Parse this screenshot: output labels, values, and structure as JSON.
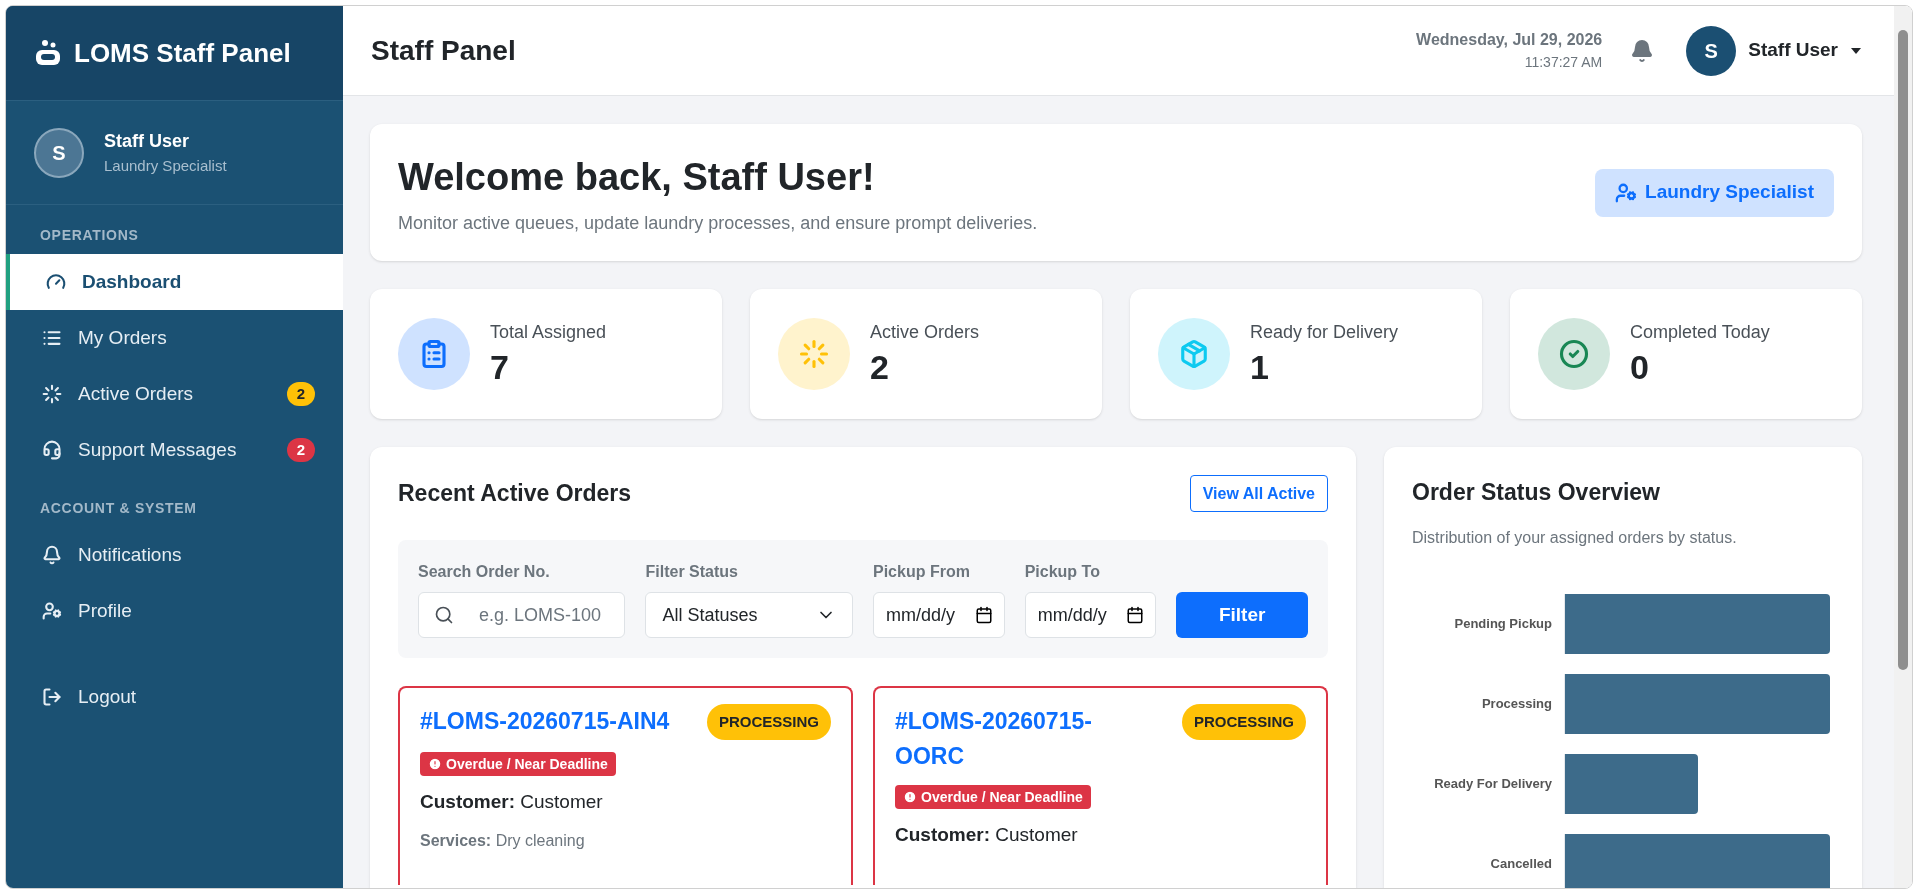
{
  "sidebar": {
    "brand": "LOMS Staff Panel",
    "user": {
      "initial": "S",
      "name": "Staff User",
      "role": "Laundry Specialist"
    },
    "sections": [
      {
        "title": "OPERATIONS",
        "items": [
          {
            "label": "Dashboard",
            "selected": true
          },
          {
            "label": "My Orders",
            "selected": false
          },
          {
            "label": "Active Orders",
            "selected": false,
            "badge": "2",
            "color": "#ffc107"
          },
          {
            "label": "Support Messages",
            "selected": false,
            "badge": "2",
            "color": "#dc3545"
          }
        ]
      },
      {
        "title": "ACCOUNT & SYSTEM",
        "items": [
          {
            "label": "Notifications",
            "selected": false
          },
          {
            "label": "Profile",
            "selected": false
          }
        ]
      }
    ],
    "logout": "Logout"
  },
  "header": {
    "title": "Staff Panel",
    "date": "Wednesday, Jul 29, 2026",
    "time": "11:37:27 AM",
    "user": {
      "initial": "S",
      "name": "Staff User"
    }
  },
  "welcome": {
    "title": "Welcome back, Staff User!",
    "subtitle": "Monitor active queues, update laundry processes, and ensure prompt deliveries.",
    "role_badge": "Laundry Specialist"
  },
  "stats": [
    {
      "label": "Total Assigned",
      "value": "7"
    },
    {
      "label": "Active Orders",
      "value": "2"
    },
    {
      "label": "Ready for Delivery",
      "value": "1"
    },
    {
      "label": "Completed Today",
      "value": "0"
    }
  ],
  "orders": {
    "title": "Recent Active Orders",
    "view_all": "View All Active",
    "filters": {
      "search_label": "Search Order No.",
      "search_placeholder": "e.g. LOMS-100",
      "status_label": "Filter Status",
      "status_value": "All Statuses",
      "from_label": "Pickup From",
      "from_placeholder": "mm/dd/y",
      "to_label": "Pickup To",
      "to_placeholder": "mm/dd/y",
      "button": "Filter"
    },
    "cards": [
      {
        "number": "#LOMS-20260715-AIN4",
        "status": "PROCESSING",
        "alert": "Overdue / Near Deadline",
        "customer_label": "Customer:",
        "customer": "Customer",
        "services_label": "Services:",
        "services": "Dry cleaning"
      },
      {
        "number": "#LOMS-20260715-OORC",
        "status": "PROCESSING",
        "alert": "Overdue / Near Deadline",
        "customer_label": "Customer:",
        "customer": "Customer"
      }
    ]
  },
  "status_overview": {
    "title": "Order Status Overview",
    "subtitle": "Distribution of your assigned orders by status.",
    "bars": [
      {
        "label": "Pending Pickup",
        "level": 1
      },
      {
        "label": "Processing",
        "level": 1
      },
      {
        "label": "Ready For Delivery",
        "level": 0.5
      },
      {
        "label": "Cancelled",
        "level": 1
      }
    ]
  }
}
